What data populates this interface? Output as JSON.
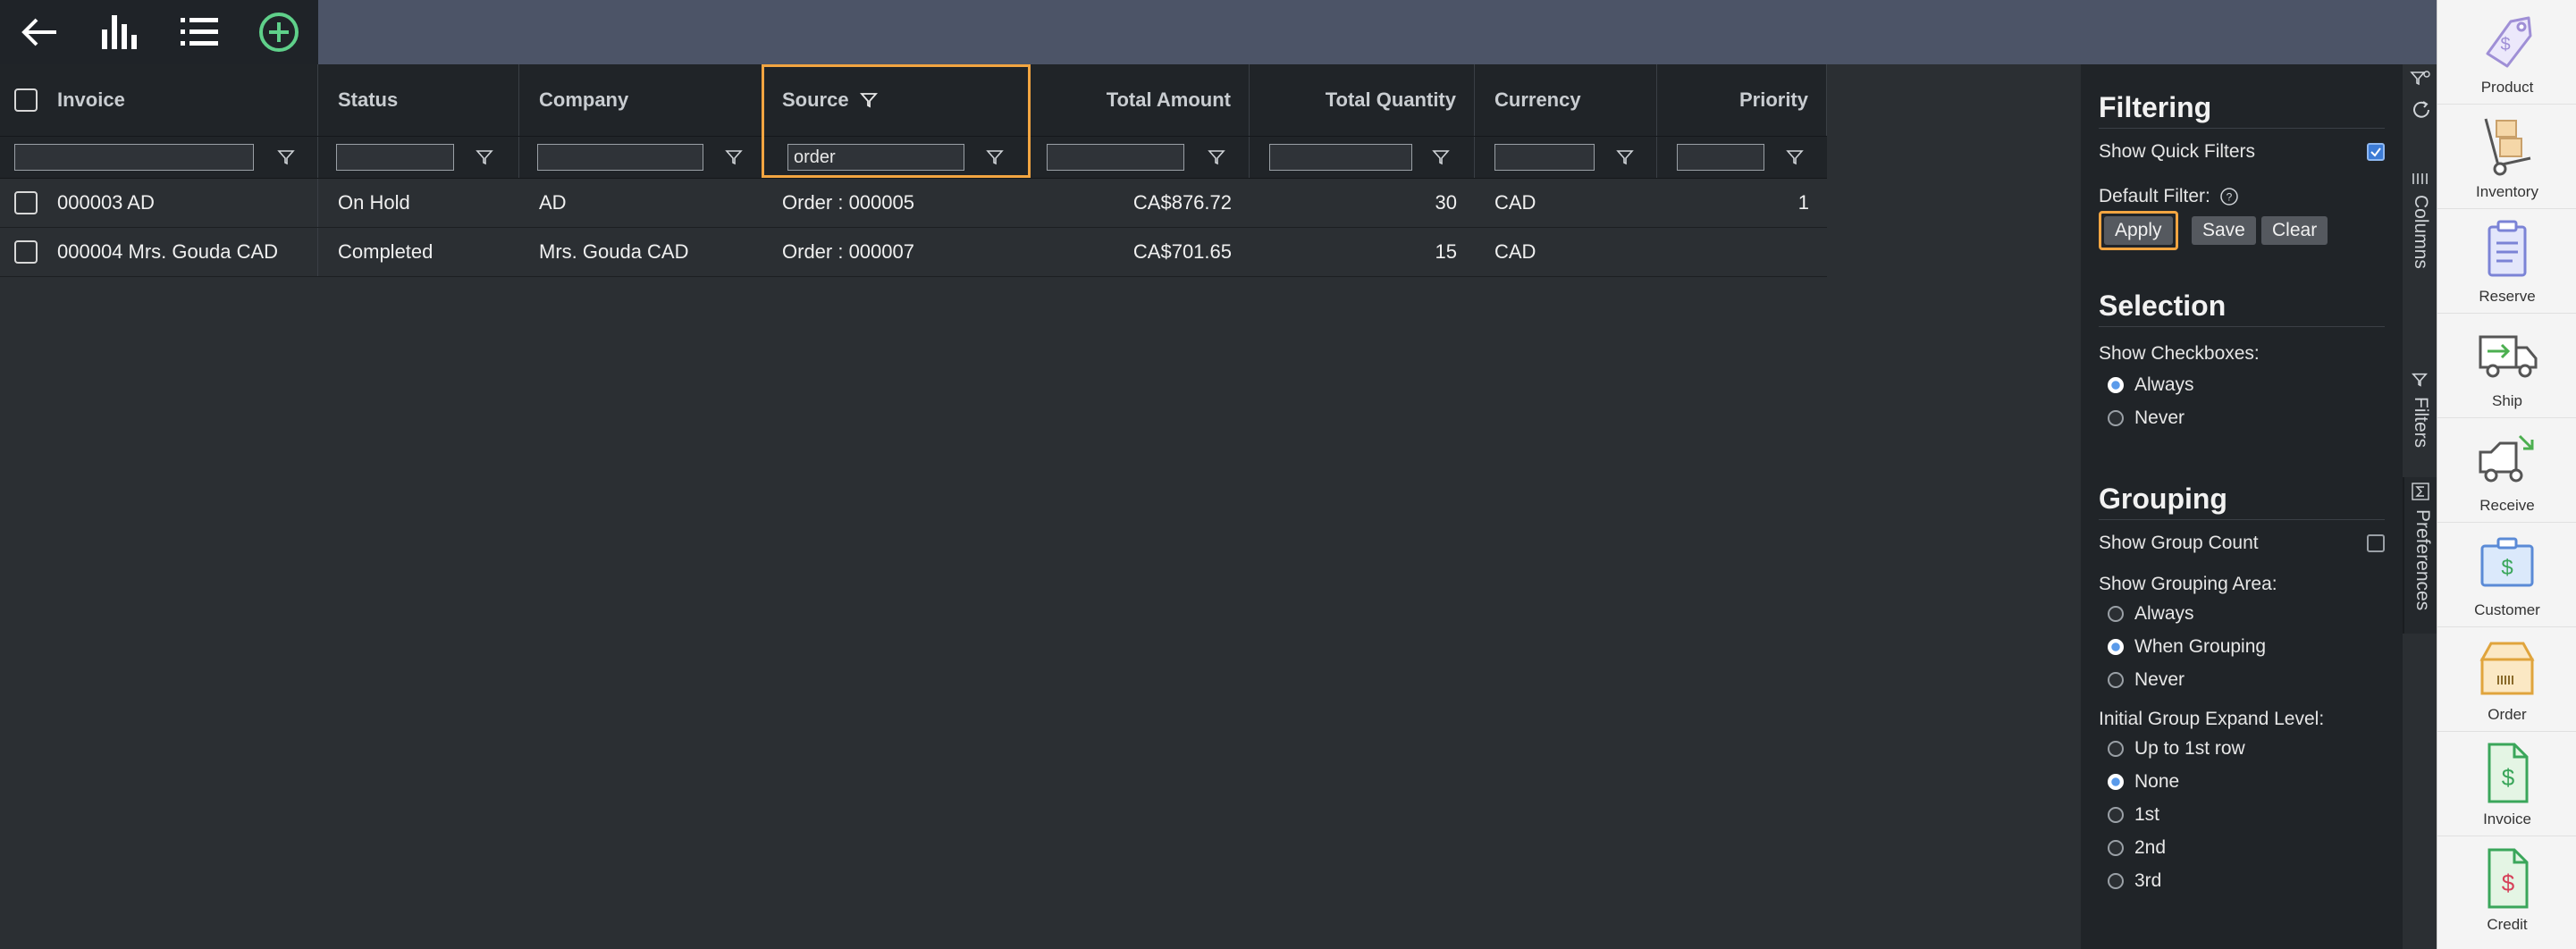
{
  "toolbar": {
    "icons": [
      "back-arrow-icon",
      "bar-chart-icon",
      "list-icon",
      "add-circle-icon"
    ]
  },
  "grid": {
    "columns": [
      {
        "key": "invoice",
        "label": "Invoice",
        "filter": ""
      },
      {
        "key": "status",
        "label": "Status",
        "filter": ""
      },
      {
        "key": "company",
        "label": "Company",
        "filter": ""
      },
      {
        "key": "source",
        "label": "Source",
        "filter": "order"
      },
      {
        "key": "total_amount",
        "label": "Total Amount",
        "filter": ""
      },
      {
        "key": "total_quantity",
        "label": "Total Quantity",
        "filter": ""
      },
      {
        "key": "currency",
        "label": "Currency",
        "filter": ""
      },
      {
        "key": "priority",
        "label": "Priority",
        "filter": ""
      }
    ],
    "rows": [
      {
        "invoice": "000003 AD",
        "status": "On Hold",
        "company": "AD",
        "source": "Order : 000005",
        "total_amount": "CA$876.72",
        "total_quantity": "30",
        "currency": "CAD",
        "priority": "1"
      },
      {
        "invoice": "000004 Mrs. Gouda CAD",
        "status": "Completed",
        "company": "Mrs. Gouda CAD",
        "source": "Order : 000007",
        "total_amount": "CA$701.65",
        "total_quantity": "15",
        "currency": "CAD",
        "priority": ""
      }
    ]
  },
  "panel": {
    "filtering": {
      "title": "Filtering",
      "show_quick_filters": "Show Quick Filters",
      "show_quick_filters_checked": true,
      "default_filter": "Default Filter:",
      "apply": "Apply",
      "save": "Save",
      "clear": "Clear"
    },
    "selection": {
      "title": "Selection",
      "show_checkboxes": "Show Checkboxes:",
      "options": [
        "Always",
        "Never"
      ],
      "selected": "Always"
    },
    "grouping": {
      "title": "Grouping",
      "show_group_count": "Show Group Count",
      "show_group_count_checked": false,
      "show_grouping_area": "Show Grouping Area:",
      "area_options": [
        "Always",
        "When Grouping",
        "Never"
      ],
      "area_selected": "When Grouping",
      "initial_expand": "Initial Group Expand Level:",
      "expand_options": [
        "Up to 1st row",
        "None",
        "1st",
        "2nd",
        "3rd"
      ],
      "expand_selected": "None"
    }
  },
  "vtabs": [
    "Columns",
    "Filters",
    "Preferences"
  ],
  "rightbar": {
    "items": [
      {
        "label": "Product",
        "icon": "price-tag-icon"
      },
      {
        "label": "Inventory",
        "icon": "hand-truck-icon"
      },
      {
        "label": "Reserve",
        "icon": "clipboard-icon"
      },
      {
        "label": "Ship",
        "icon": "delivery-truck-out-icon"
      },
      {
        "label": "Receive",
        "icon": "delivery-truck-in-icon"
      },
      {
        "label": "Customer",
        "icon": "customer-briefcase-icon"
      },
      {
        "label": "Order",
        "icon": "order-box-icon"
      },
      {
        "label": "Invoice",
        "icon": "invoice-document-icon"
      },
      {
        "label": "Credit",
        "icon": "credit-document-icon"
      }
    ]
  },
  "colors": {
    "highlight": "#f2a541",
    "topbar": "#4c5467",
    "accent_green": "#5fd08a"
  }
}
